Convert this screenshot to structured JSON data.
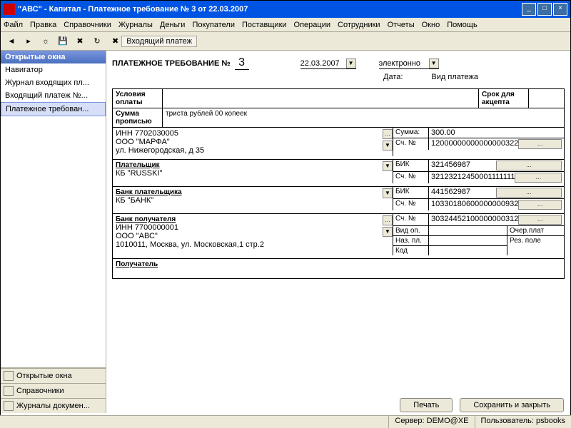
{
  "title": "\"АВС\" - Капитал - Платежное требование № 3 от 22.03.2007",
  "menu": [
    "Файл",
    "Правка",
    "Справочники",
    "Журналы",
    "Деньги",
    "Покупатели",
    "Поставщики",
    "Операции",
    "Сотрудники",
    "Отчеты",
    "Окно",
    "Помощь"
  ],
  "tab": "Входящий платеж",
  "sidebar": {
    "header": "Открытые окна",
    "items": [
      "Навигатор",
      "Журнал входящих пл...",
      "Входящий платеж №...",
      "Платежное требован..."
    ],
    "buttons": [
      "Открытые окна",
      "Справочники",
      "Журналы докумен..."
    ]
  },
  "doc": {
    "main_title": "ПЛАТЕЖНОЕ ТРЕБОВАНИЕ №",
    "num": "3",
    "date": "22.03.2007",
    "date_lbl": "Дата:",
    "paytype": "электронно",
    "paytype_lbl": "Вид платежа",
    "cond_lbl": "Условия оплаты",
    "deadline_lbl": "Срок для акцепта",
    "sum_words_lbl": "Сумма прописью",
    "sum_words": "триста рублей 00 копеек",
    "inn1": "ИНН  7702030005",
    "org1": "ООО \"МАРФА\"",
    "addr1": "ул. Нижегородская, д 35",
    "sum_lbl": "Сумма:",
    "sum": "300.00",
    "sch_lbl": "Сч. №",
    "sch1": "12000000000000000322",
    "payer_lbl": "Плательщик",
    "bank1": "КБ \"RUSSKI\"",
    "bik_lbl": "БИК",
    "bik1": "321456987",
    "sch2": "32123212450001111111",
    "bankpayer_lbl": "Банк плательщика",
    "bank2": "КБ \"БАНК\"",
    "bik2": "441562987",
    "sch3": "10330180600000000932",
    "bankrecv_lbl": "Банк получателя",
    "inn2": "ИНН  7700000001",
    "org2": "ООО \"АВС\"",
    "addr2": "1010011, Москва, ул. Московская,1 стр.2",
    "sch4": "30324452100000000312",
    "vidop": "Вид оп.",
    "nazpl": "Наз. пл.",
    "kod": "Код",
    "ocher": "Очер.плат",
    "rezpole": "Рез. поле",
    "recv_lbl": "Получатель"
  },
  "buttons": {
    "print": "Печать",
    "save": "Сохранить и закрыть"
  },
  "status": {
    "server_lbl": "Сервер:",
    "server": "DEMO@XE",
    "user_lbl": "Пользователь:",
    "user": "psbooks"
  }
}
